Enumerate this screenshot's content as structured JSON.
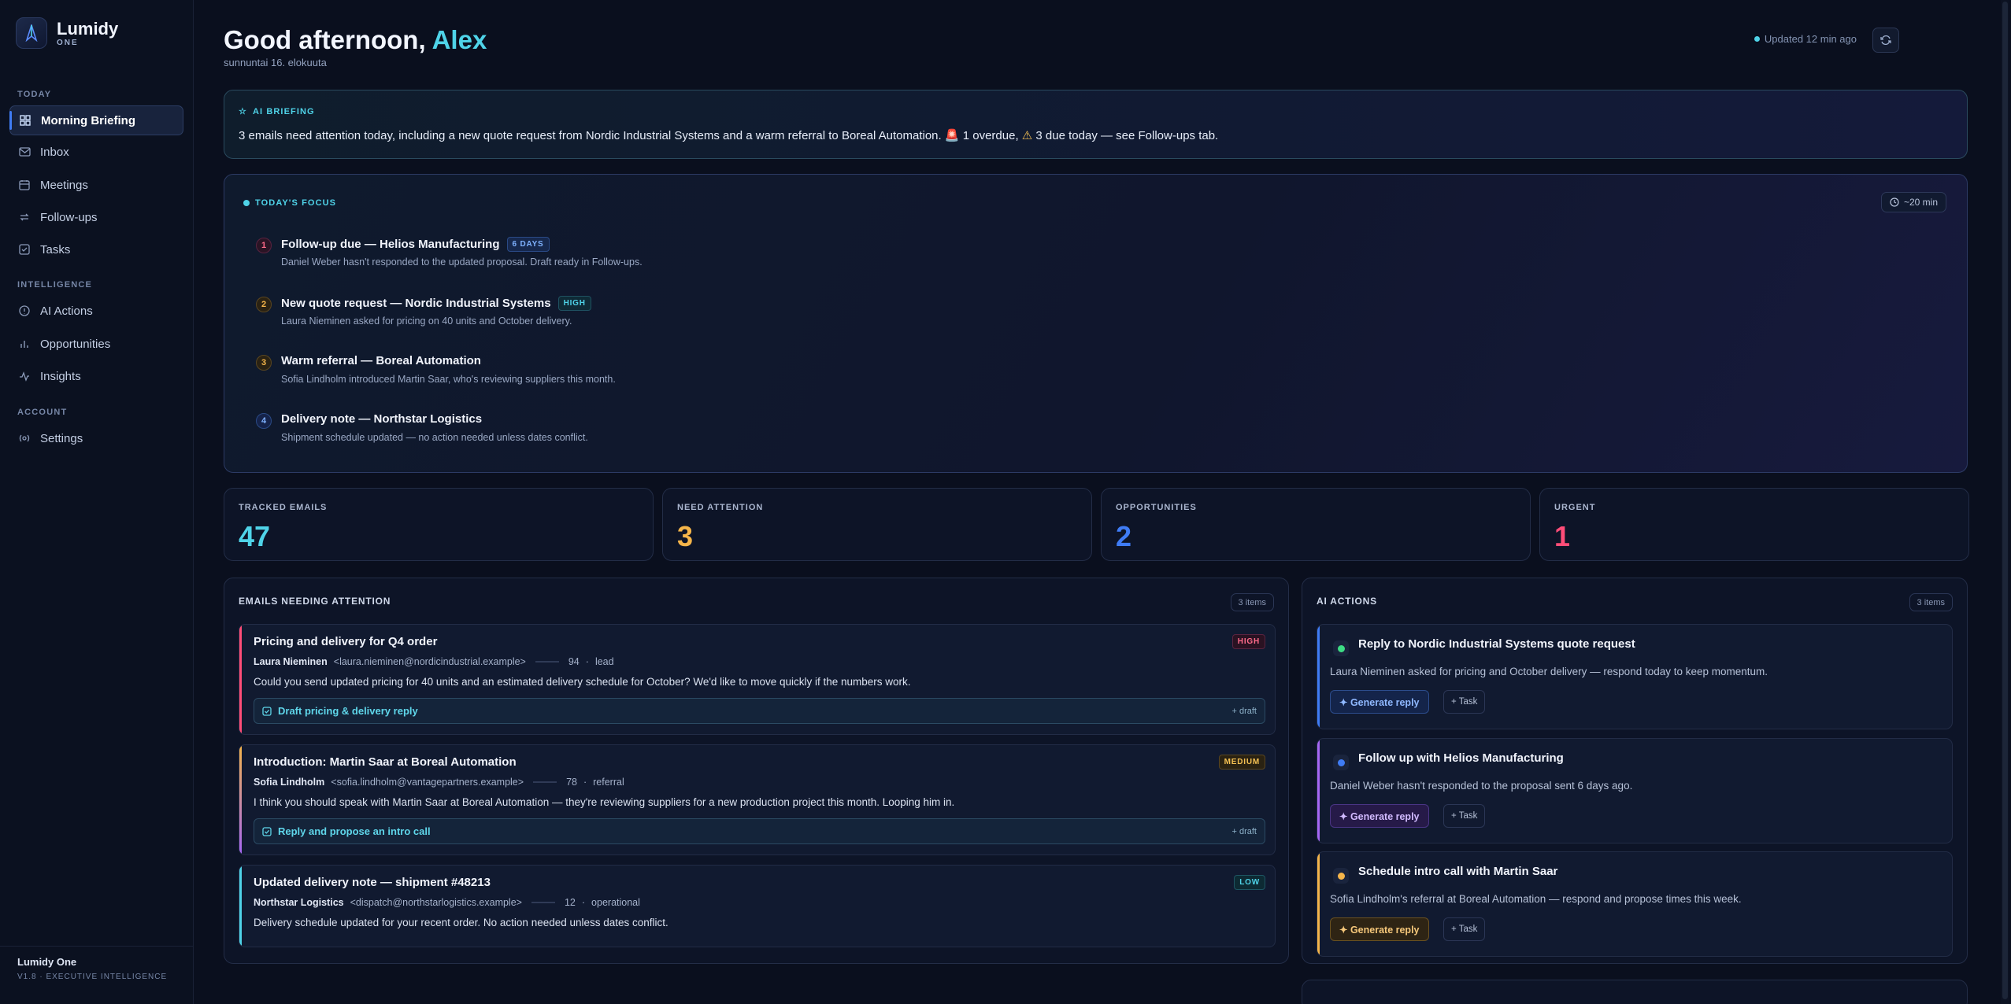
{
  "brand": {
    "name": "Lumidy",
    "sub": "ONE"
  },
  "nav": {
    "sections": {
      "today": "TODAY",
      "intelligence": "INTELLIGENCE",
      "account": "ACCOUNT"
    },
    "items": [
      {
        "label": "Morning Briefing",
        "icon": "grid-icon"
      },
      {
        "label": "Inbox",
        "icon": "mail-icon"
      },
      {
        "label": "Meetings",
        "icon": "calendar-icon"
      },
      {
        "label": "Follow-ups",
        "icon": "refresh-icon"
      },
      {
        "label": "Tasks",
        "icon": "check-square-icon"
      },
      {
        "label": "AI Actions",
        "icon": "circle-icon"
      },
      {
        "label": "Opportunities",
        "icon": "bar-chart-icon"
      },
      {
        "label": "Insights",
        "icon": "activity-icon"
      },
      {
        "label": "Settings",
        "icon": "settings-icon"
      }
    ],
    "footer": {
      "title": "Lumidy One",
      "version": "V1.8 · EXECUTIVE INTELLIGENCE"
    }
  },
  "header": {
    "greeting": "Good afternoon,",
    "name": "Alex",
    "date": "sunnuntai 16. elokuuta",
    "updated": "Updated 12 min ago"
  },
  "briefing": {
    "tag": "AI BRIEFING",
    "text_a": "3 emails need attention today, including a new quote request from Nordic Industrial Systems and a warm referral to Boreal Automation.",
    "text_b": "1 overdue,",
    "text_c": "3 due today — see Follow-ups tab."
  },
  "focus": {
    "tag": "TODAY'S FOCUS",
    "time": "~20 min",
    "items": [
      {
        "n": "1",
        "title": "Follow-up due — Helios Manufacturing",
        "badge": "6 DAYS",
        "sub": "Daniel Weber hasn't responded to the updated proposal. Draft ready in Follow-ups."
      },
      {
        "n": "2",
        "title": "New quote request — Nordic Industrial Systems",
        "badge": "HIGH",
        "sub": "Laura Nieminen asked for pricing on 40 units and October delivery."
      },
      {
        "n": "3",
        "title": "Warm referral — Boreal Automation",
        "sub": "Sofia Lindholm introduced Martin Saar, who's reviewing suppliers this month."
      },
      {
        "n": "4",
        "title": "Delivery note — Northstar Logistics",
        "sub": "Shipment schedule updated — no action needed unless dates conflict."
      }
    ]
  },
  "stats": [
    {
      "label": "TRACKED EMAILS",
      "value": "47",
      "color": "#4fd3e8"
    },
    {
      "label": "NEED ATTENTION",
      "value": "3",
      "color": "#f5b54a"
    },
    {
      "label": "OPPORTUNITIES",
      "value": "2",
      "color": "#3f7cf5"
    },
    {
      "label": "URGENT",
      "value": "1",
      "color": "#ff4d78"
    }
  ],
  "emails": {
    "title": "EMAILS NEEDING ATTENTION",
    "count": "3 items",
    "items": [
      {
        "subject": "Pricing and delivery for Q4 order",
        "priority": "HIGH",
        "sender": "Laura Nieminen",
        "address": "<laura.nieminen@nordicindustrial.example>",
        "score": "94",
        "category": "lead",
        "body": "Could you send updated pricing for 40 units and an estimated delivery schedule for October? We'd like to move quickly if the numbers work.",
        "draft": "Draft pricing & delivery reply",
        "draft_tag": "+ draft"
      },
      {
        "subject": "Introduction: Martin Saar at Boreal Automation",
        "priority": "MEDIUM",
        "sender": "Sofia Lindholm",
        "address": "<sofia.lindholm@vantagepartners.example>",
        "score": "78",
        "category": "referral",
        "body": "I think you should speak with Martin Saar at Boreal Automation — they're reviewing suppliers for a new production project this month. Looping him in.",
        "draft": "Reply and propose an intro call",
        "draft_tag": "+ draft"
      },
      {
        "subject": "Updated delivery note — shipment #48213",
        "priority": "LOW",
        "sender": "Northstar Logistics",
        "address": "<dispatch@northstarlogistics.example>",
        "score": "12",
        "category": "operational",
        "body": "Delivery schedule updated for your recent order. No action needed unless dates conflict."
      }
    ]
  },
  "actions": {
    "title": "AI ACTIONS",
    "count": "3 items",
    "items": [
      {
        "title": "Reply to Nordic Industrial Systems quote request",
        "desc": "Laura Nieminen asked for pricing and October delivery — respond today to keep momentum.",
        "gen": "✦ Generate reply",
        "task": "+ Task"
      },
      {
        "title": "Follow up with Helios Manufacturing",
        "desc": "Daniel Weber hasn't responded to the proposal sent 6 days ago.",
        "gen": "✦ Generate reply",
        "task": "+ Task"
      },
      {
        "title": "Schedule intro call with Martin Saar",
        "desc": "Sofia Lindholm's referral at Boreal Automation — respond and propose times this week.",
        "gen": "✦ Generate reply",
        "task": "+ Task"
      }
    ]
  }
}
